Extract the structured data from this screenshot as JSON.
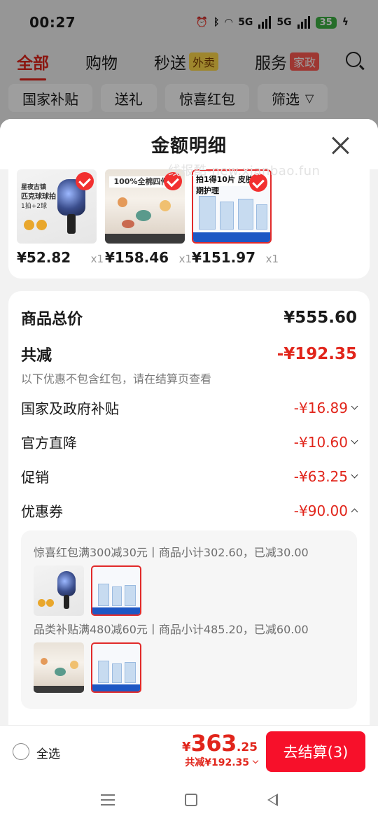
{
  "status_bar": {
    "time": "00:27",
    "network_1": "5G",
    "network_2": "5G",
    "battery": "35"
  },
  "top_tabs": [
    {
      "label": "全部",
      "tag": ""
    },
    {
      "label": "购物",
      "tag": ""
    },
    {
      "label": "秒送",
      "tag": "外卖"
    },
    {
      "label": "服务",
      "tag": "家政"
    }
  ],
  "filter_chips": [
    "国家补贴",
    "送礼",
    "惊喜红包",
    "筛选"
  ],
  "sheet": {
    "title": "金额明细",
    "watermark": "线报酷-new.xianbao.fun",
    "products": [
      {
        "name": "匹克球球拍",
        "art_text_1": "星夜古镇",
        "art_text_2": "匹克球球拍",
        "art_text_3": "1拍+2球",
        "price": "¥52.82",
        "qty": "x1"
      },
      {
        "name": "全棉四件套",
        "art_text_1": "100%全棉四件套",
        "price": "¥158.46",
        "qty": "x1"
      },
      {
        "name": "皮肤周期护理",
        "art_text_1": "拍1得10片 皮肤周期护理",
        "price": "¥151.97",
        "qty": "x1"
      }
    ],
    "summary": {
      "total_label": "商品总价",
      "total_value": "¥555.60",
      "reduce_label": "共减",
      "reduce_value": "-¥192.35",
      "note": "以下优惠不包含红包，请在结算页查看",
      "items": [
        {
          "label": "国家及政府补贴",
          "value": "-¥16.89",
          "expanded": false
        },
        {
          "label": "官方直降",
          "value": "-¥10.60",
          "expanded": false
        },
        {
          "label": "促销",
          "value": "-¥63.25",
          "expanded": false
        },
        {
          "label": "优惠券",
          "value": "-¥90.00",
          "expanded": true
        }
      ],
      "coupons": [
        {
          "text": "惊喜红包满300减30元丨商品小计302.60，已减30.00"
        },
        {
          "text": "品类补贴满480减60元丨商品小计485.20，已减60.00"
        }
      ]
    }
  },
  "bottom_bar": {
    "select_all": "全选",
    "yen": "¥",
    "final_int": "363",
    "final_dec": ".25",
    "reduce_text": "共减¥192.35",
    "checkout": "去结算(3)"
  },
  "colors": {
    "accent": "#e1251b",
    "checkout": "#f7102a"
  }
}
